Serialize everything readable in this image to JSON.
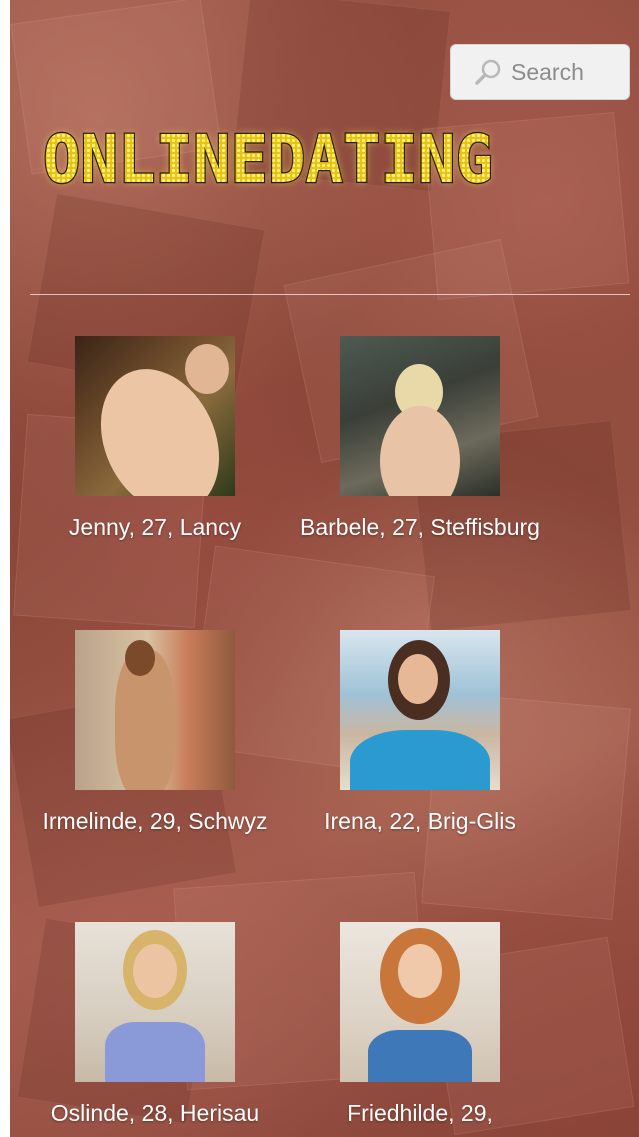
{
  "search": {
    "label": "Search",
    "icon": "search-icon"
  },
  "logo": {
    "text": "ONLINEDATING",
    "fill_color": "#f2d21a",
    "glow_color": "#fff36a",
    "outline_color": "#2a1d04"
  },
  "theme": {
    "background_tint": "#8e4a3c",
    "caption_color": "#ffffff"
  },
  "profiles": [
    {
      "caption": "Jenny, 27, Lancy",
      "photo_tone": "warm-wood"
    },
    {
      "caption": "Barbele, 27, Steffisburg",
      "photo_tone": "stone-gray"
    },
    {
      "caption": "Irmelinde, 29, Schwyz",
      "photo_tone": "interior-warm"
    },
    {
      "caption": "Irena, 22, Brig-Glis",
      "photo_tone": "sea-blue"
    },
    {
      "caption": "Oslinde, 28, Herisau",
      "photo_tone": "light-room"
    },
    {
      "caption": "Friedhilde, 29,",
      "photo_tone": "light-room-blue"
    }
  ]
}
